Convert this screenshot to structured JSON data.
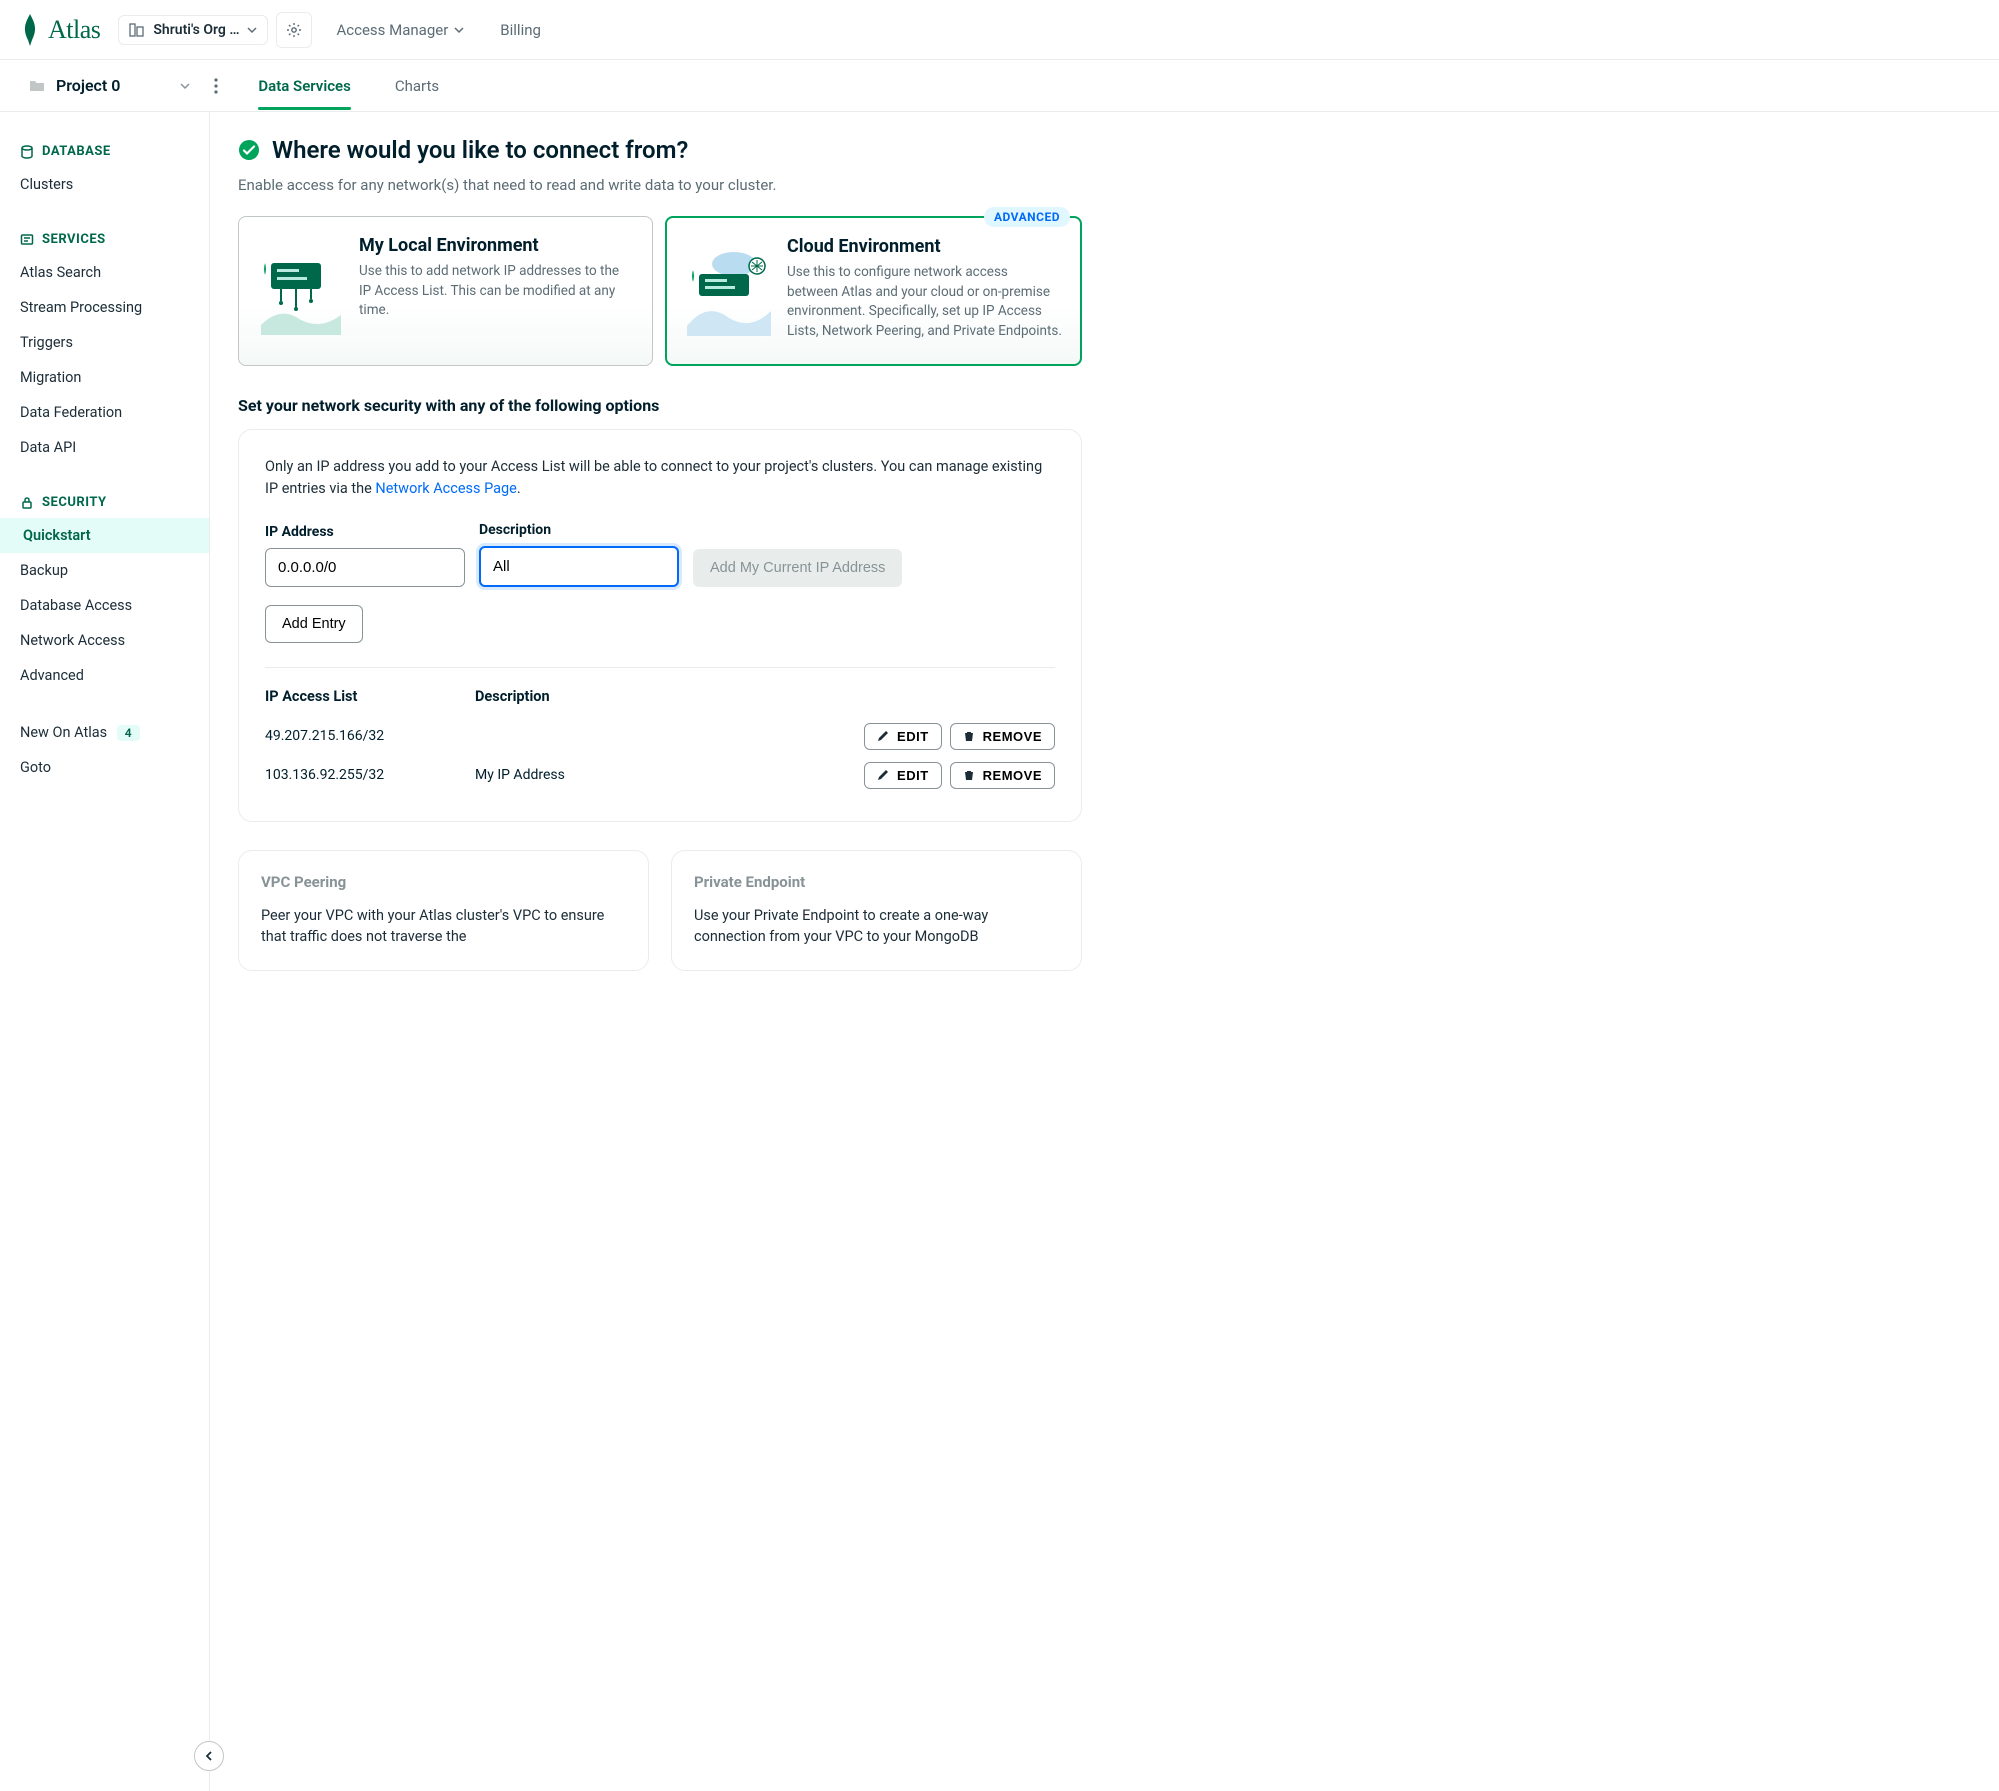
{
  "brand": {
    "name": "Atlas"
  },
  "topbar": {
    "org_label": "Shruti's Org …",
    "nav": {
      "access_manager": "Access Manager",
      "billing": "Billing"
    }
  },
  "subbar": {
    "project_name": "Project 0",
    "tabs": {
      "data_services": "Data Services",
      "charts": "Charts"
    }
  },
  "sidebar": {
    "database_header": "DATABASE",
    "clusters": "Clusters",
    "services_header": "SERVICES",
    "atlas_search": "Atlas Search",
    "stream_processing": "Stream Processing",
    "triggers": "Triggers",
    "migration": "Migration",
    "data_federation": "Data Federation",
    "data_api": "Data API",
    "security_header": "SECURITY",
    "quickstart": "Quickstart",
    "backup": "Backup",
    "database_access": "Database Access",
    "network_access": "Network Access",
    "advanced": "Advanced",
    "new_on_atlas": "New On Atlas",
    "new_count": "4",
    "goto": "Goto"
  },
  "main": {
    "title": "Where would you like to connect from?",
    "subtitle": "Enable access for any network(s) that need to read and write data to your cluster.",
    "local_card": {
      "title": "My Local Environment",
      "desc": "Use this to add network IP addresses to the IP Access List. This can be modified at any time."
    },
    "cloud_card": {
      "title": "Cloud Environment",
      "badge": "ADVANCED",
      "desc": "Use this to configure network access between Atlas and your cloud or on-premise environment. Specifically, set up IP Access Lists, Network Peering, and Private Endpoints."
    },
    "net_security_heading": "Set your network security with any of the following options",
    "panel_intro_a": "Only an IP address you add to your Access List will be able to connect to your project's clusters. You can manage existing IP entries via the ",
    "panel_intro_link": "Network Access Page",
    "panel_intro_b": ".",
    "ip_label": "IP Address",
    "desc_label": "Description",
    "ip_value": "0.0.0.0/0",
    "desc_value": "All",
    "add_current_ip": "Add My Current IP Address",
    "add_entry": "Add Entry",
    "list_header_ip": "IP Access List",
    "list_header_desc": "Description",
    "edit_label": "EDIT",
    "remove_label": "REMOVE",
    "rows": [
      {
        "ip": "49.207.215.166/32",
        "desc": ""
      },
      {
        "ip": "103.136.92.255/32",
        "desc": "My IP Address"
      }
    ],
    "vpc_card": {
      "title": "VPC Peering",
      "desc": "Peer your VPC with your Atlas cluster's VPC to ensure that traffic does not traverse the"
    },
    "pe_card": {
      "title": "Private Endpoint",
      "desc": "Use your Private Endpoint to create a one-way connection from your VPC to your MongoDB"
    }
  }
}
